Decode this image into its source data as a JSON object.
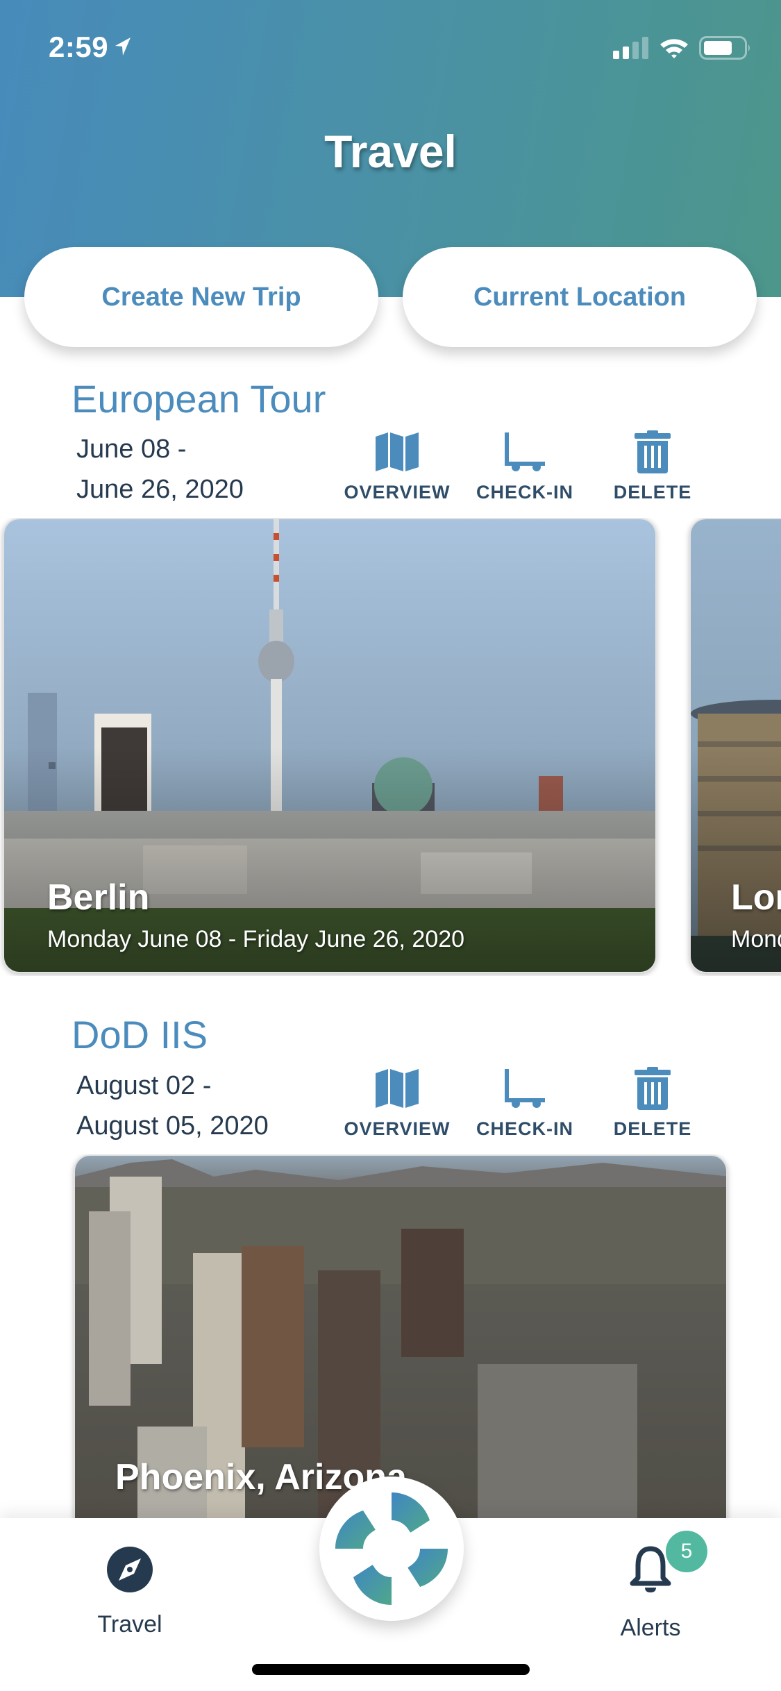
{
  "status_bar": {
    "time": "2:59",
    "location_icon": "location-arrow-icon",
    "signal_icon": "cellular-signal-icon",
    "wifi_icon": "wifi-icon",
    "battery_icon": "battery-icon"
  },
  "header": {
    "title": "Travel",
    "gradient_start": "#478bbb",
    "gradient_end": "#4c968b"
  },
  "buttons": {
    "create_trip": "Create New Trip",
    "current_location": "Current Location"
  },
  "trips": [
    {
      "name": "European Tour",
      "date_start": "June 08  -",
      "date_end": "June 26, 2020",
      "actions": [
        {
          "label": "OVERVIEW",
          "icon": "map-icon"
        },
        {
          "label": "CHECK-IN",
          "icon": "luggage-cart-icon"
        },
        {
          "label": "DELETE",
          "icon": "trash-icon"
        }
      ],
      "destinations": [
        {
          "city": "Berlin",
          "range": "Monday June 08 -  Friday June 26, 2020"
        },
        {
          "city": "London",
          "range": "Monday"
        }
      ]
    },
    {
      "name": "DoD IIS",
      "date_start": "August 02  -",
      "date_end": "August 05, 2020",
      "actions": [
        {
          "label": "OVERVIEW",
          "icon": "map-icon"
        },
        {
          "label": "CHECK-IN",
          "icon": "luggage-cart-icon"
        },
        {
          "label": "DELETE",
          "icon": "trash-icon"
        }
      ],
      "destinations": [
        {
          "city": "Phoenix, Arizona",
          "range": ""
        }
      ]
    }
  ],
  "bottom_nav": {
    "travel_label": "Travel",
    "alerts_label": "Alerts",
    "alerts_count": "5",
    "accent": "#52b9a0",
    "dark": "#263a4f"
  },
  "colors": {
    "primary_blue": "#4b8cbd",
    "label_dark": "#2f4d68"
  }
}
